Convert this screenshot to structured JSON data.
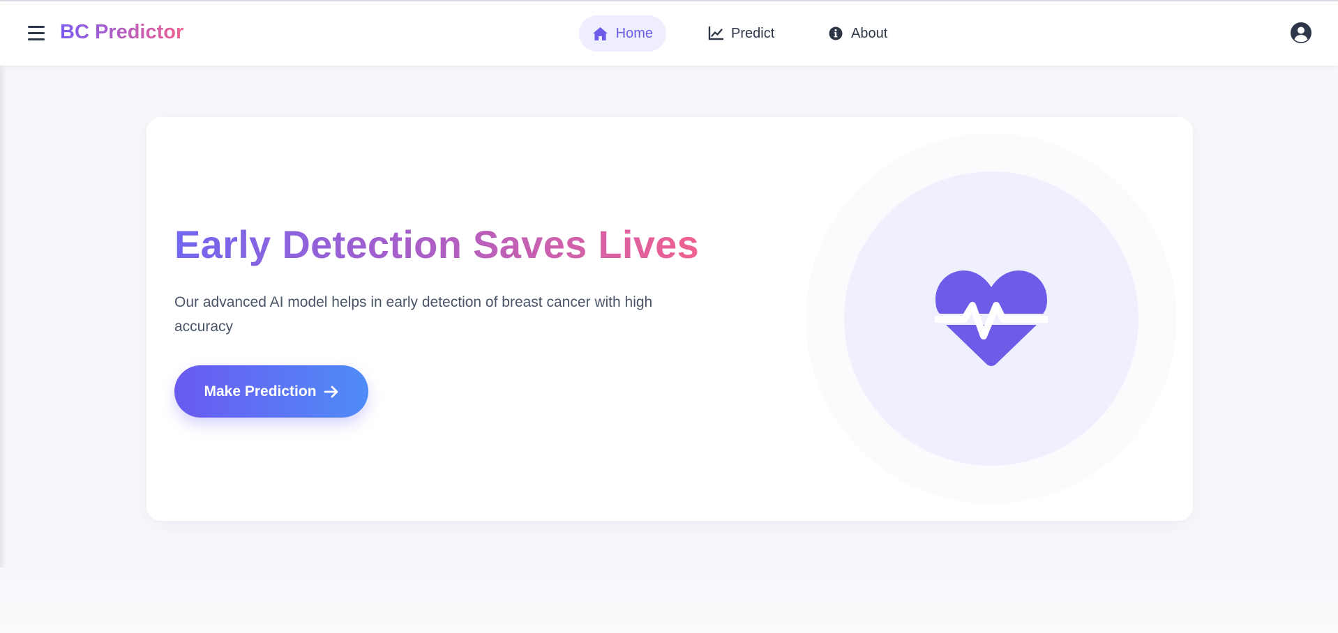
{
  "brand": {
    "name": "BC Predictor"
  },
  "nav": {
    "items": [
      {
        "label": "Home",
        "icon": "home-icon",
        "active": true
      },
      {
        "label": "Predict",
        "icon": "chart-line-icon",
        "active": false
      },
      {
        "label": "About",
        "icon": "info-circle-icon",
        "active": false
      }
    ]
  },
  "hero": {
    "title": "Early Detection Saves Lives",
    "subtitle": "Our advanced AI model helps in early detection of breast cancer with high accuracy",
    "cta_label": "Make Prediction",
    "illustration_icon": "heart-pulse-icon"
  },
  "icons": {
    "menu": "hamburger-menu-icon",
    "user": "user-circle-icon",
    "cta_arrow": "arrow-right-icon"
  },
  "colors": {
    "accent": "#6c5ce7",
    "accent_blue": "#4f8cf7",
    "brand_pink": "#ef6192",
    "active_nav_bg": "#efeefe",
    "illustration_bg": "#f0effe"
  }
}
